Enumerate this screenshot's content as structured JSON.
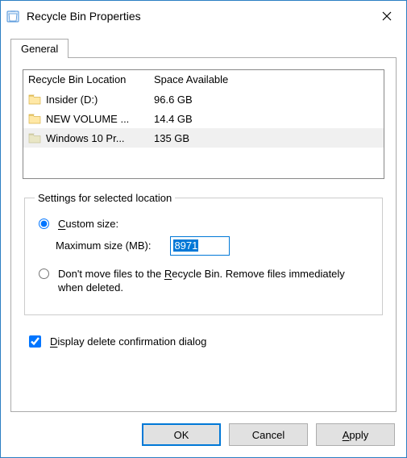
{
  "window": {
    "title": "Recycle Bin Properties"
  },
  "tabs": {
    "general": "General"
  },
  "list": {
    "headers": {
      "location": "Recycle Bin Location",
      "space": "Space Available"
    },
    "rows": [
      {
        "name": "Insider (D:)",
        "space": "96.6 GB",
        "selected": false
      },
      {
        "name": "NEW VOLUME ...",
        "space": "14.4 GB",
        "selected": false
      },
      {
        "name": "Windows 10 Pr...",
        "space": "135 GB",
        "selected": true
      }
    ]
  },
  "settings": {
    "legend": "Settings for selected location",
    "custom_prefix": "C",
    "custom_rest": "ustom size:",
    "maxsize_label": "Maximum size (MB):",
    "maxsize_value": "8971",
    "dontmove_before": "Don't move files to the ",
    "dontmove_letter": "R",
    "dontmove_after": "ecycle Bin. Remove files immediately when deleted.",
    "radio_custom_checked": true,
    "radio_dontmove_checked": false
  },
  "confirm": {
    "checked": true,
    "before": "",
    "letter": "D",
    "after": "isplay delete confirmation dialog"
  },
  "buttons": {
    "ok": "OK",
    "cancel": "Cancel",
    "apply_letter": "A",
    "apply_rest": "pply"
  }
}
